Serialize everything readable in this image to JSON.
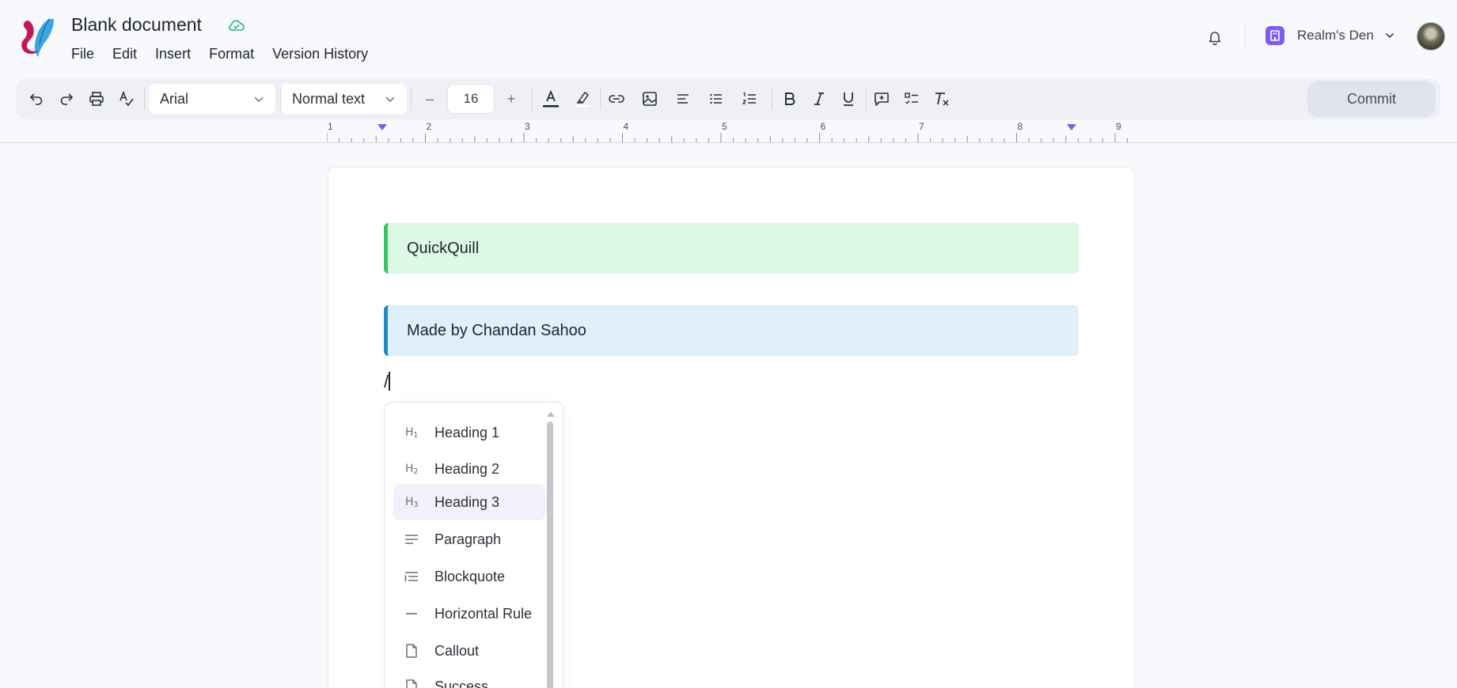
{
  "header": {
    "title": "Blank document",
    "menu": [
      "File",
      "Edit",
      "Insert",
      "Format",
      "Version History"
    ],
    "workspace": "Realm's Den"
  },
  "toolbar": {
    "font": "Arial",
    "style": "Normal text",
    "font_size": "16",
    "minus": "–",
    "plus": "+",
    "commit_label": "Commit"
  },
  "ruler": {
    "numbers": [
      "1",
      "2",
      "3",
      "4",
      "5",
      "6",
      "7",
      "8",
      "9"
    ]
  },
  "document": {
    "callouts": [
      "QuickQuill",
      "Made by Chandan Sahoo"
    ],
    "command_text": "/"
  },
  "slash_menu": {
    "items": [
      {
        "label": "Heading 1",
        "icon": "heading-1-icon"
      },
      {
        "label": "Heading 2",
        "icon": "heading-2-icon"
      },
      {
        "label": "Heading 3",
        "icon": "heading-3-icon"
      },
      {
        "label": "Paragraph",
        "icon": "paragraph-icon"
      },
      {
        "label": "Blockquote",
        "icon": "blockquote-icon"
      },
      {
        "label": "Horizontal Rule",
        "icon": "horizontal-rule-icon"
      },
      {
        "label": "Callout",
        "icon": "callout-icon"
      },
      {
        "label": "Success",
        "icon": "success-icon"
      }
    ],
    "highlighted_index": 2
  },
  "colors": {
    "accent": "#7c5cf3",
    "success_border": "#34c55e",
    "info_border": "#1e8bc3"
  }
}
